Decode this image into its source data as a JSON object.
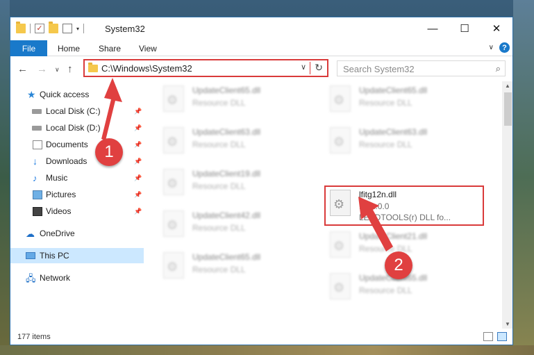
{
  "window": {
    "title": "System32",
    "controls": {
      "minimize": "—",
      "maximize": "☐",
      "close": "✕"
    }
  },
  "ribbon": {
    "file": "File",
    "tabs": [
      "Home",
      "Share",
      "View"
    ]
  },
  "address": {
    "path": "C:\\Windows\\System32",
    "search_placeholder": "Search System32"
  },
  "sidebar": {
    "items": [
      {
        "label": "Quick access",
        "icon": "star-icon",
        "pinned": false
      },
      {
        "label": "Local Disk (C:)",
        "icon": "drive-icon",
        "pinned": true
      },
      {
        "label": "Local Disk (D:)",
        "icon": "drive-icon",
        "pinned": true
      },
      {
        "label": "Documents",
        "icon": "documents-icon",
        "pinned": true
      },
      {
        "label": "Downloads",
        "icon": "download-icon",
        "pinned": true
      },
      {
        "label": "Music",
        "icon": "music-icon",
        "pinned": true
      },
      {
        "label": "Pictures",
        "icon": "pictures-icon",
        "pinned": true
      },
      {
        "label": "Videos",
        "icon": "videos-icon",
        "pinned": true
      },
      {
        "label": "OneDrive",
        "icon": "cloud-icon",
        "pinned": false
      },
      {
        "label": "This PC",
        "icon": "computer-icon",
        "pinned": false,
        "selected": true
      },
      {
        "label": "Network",
        "icon": "network-icon",
        "pinned": false
      }
    ]
  },
  "files": [
    {
      "name": "UpdateClient65.dll",
      "type": "Resource DLL"
    },
    {
      "name": "UpdateClient65.dll",
      "type": "Resource DLL"
    },
    {
      "name": "UpdateClient63.dll",
      "type": "Resource DLL"
    },
    {
      "name": "UpdateClient63.dll",
      "type": "Resource DLL"
    },
    {
      "name": "UpdateClient19.dll",
      "type": "Resource DLL"
    },
    {
      "name": "lfitg12n.dll",
      "version": "12.1.0.0",
      "type": "LEADTOOLS(r) DLL fo...",
      "highlighted": true
    },
    {
      "name": "UpdateClient42.dll",
      "type": "Resource DLL"
    },
    {
      "name": "UpdateClient21.dll",
      "type": "Resource DLL"
    },
    {
      "name": "UpdateClient65.dll",
      "type": "Resource DLL"
    },
    {
      "name": "UpdateClient65.dll",
      "type": "Resource DLL"
    }
  ],
  "status": {
    "items": "177 items"
  },
  "callouts": {
    "one": "1",
    "two": "2"
  },
  "colors": {
    "accent": "#1979ca",
    "highlight": "#d93a3a",
    "selected": "#cce8ff"
  }
}
